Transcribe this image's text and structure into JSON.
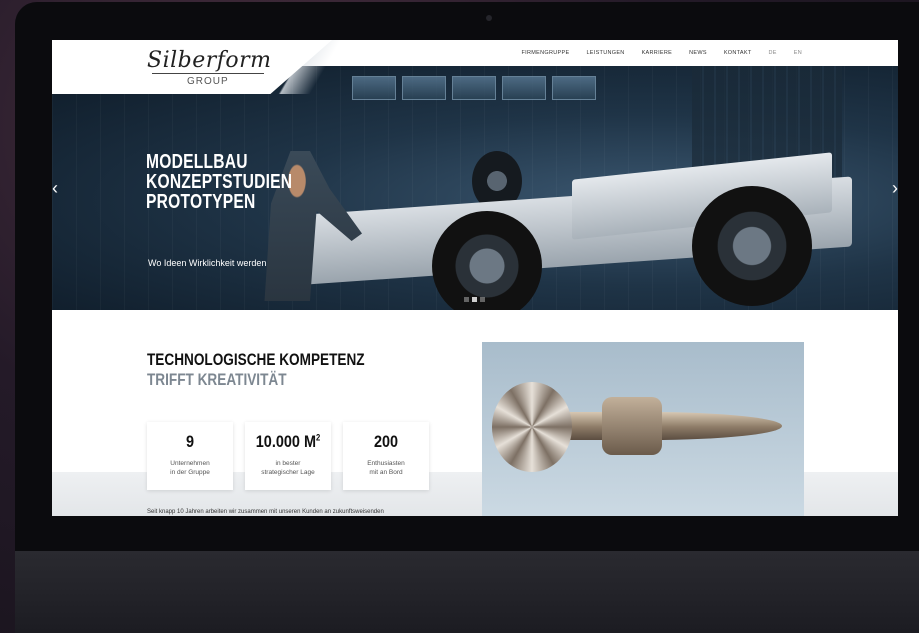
{
  "logo": {
    "wordmark": "Silberform",
    "subtitle": "GROUP"
  },
  "nav": {
    "items": [
      "FIRMENGRUPPE",
      "LEISTUNGEN",
      "KARRIERE",
      "NEWS",
      "KONTAKT"
    ],
    "languages": [
      "DE",
      "EN"
    ]
  },
  "hero": {
    "lines": [
      "MODELLBAU",
      "KONZEPTSTUDIEN",
      "PROTOTYPEN"
    ],
    "subtitle": "Wo Ideen Wirklichkeit werden",
    "prev_arrow": "‹",
    "next_arrow": "›",
    "slide_count": 3,
    "active_slide": 2
  },
  "content": {
    "heading_line1": "TECHNOLOGISCHE KOMPETENZ",
    "heading_line2": "TRIFFT KREATIVITÄT",
    "stats": [
      {
        "value": "9",
        "label_line1": "Unternehmen",
        "label_line2": "in der Gruppe"
      },
      {
        "value": "10.000 M",
        "value_sup": "2",
        "label_line1": "in bester",
        "label_line2": "strategischer Lage"
      },
      {
        "value": "200",
        "label_line1": "Enthusiasten",
        "label_line2": "mit an Bord"
      }
    ],
    "body_text": "Seit knapp 10 Jahren arbeiten wir zusammen mit unseren Kunden an zukunftsweisenden"
  },
  "colors": {
    "heading_dark": "#111111",
    "heading_gray": "#7d8791",
    "hero_bg": "#1f3447"
  }
}
